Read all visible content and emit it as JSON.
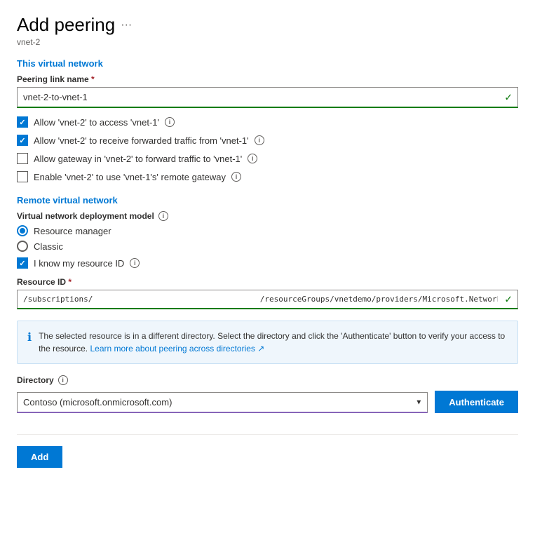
{
  "page": {
    "title": "Add peering",
    "ellipsis": "···",
    "subtitle": "vnet-2"
  },
  "thisVnet": {
    "heading": "This virtual network",
    "peeringLinkLabel": "Peering link name",
    "peeringLinkValue": "vnet-2-to-vnet-1",
    "checkboxes": [
      {
        "id": "cb1",
        "label": "Allow 'vnet-2' to access 'vnet-1'",
        "checked": true
      },
      {
        "id": "cb2",
        "label": "Allow 'vnet-2' to receive forwarded traffic from 'vnet-1'",
        "checked": true
      },
      {
        "id": "cb3",
        "label": "Allow gateway in 'vnet-2' to forward traffic to 'vnet-1'",
        "checked": false
      },
      {
        "id": "cb4",
        "label": "Enable 'vnet-2' to use 'vnet-1's' remote gateway",
        "checked": false
      }
    ]
  },
  "remoteVnet": {
    "heading": "Remote virtual network",
    "deploymentModelLabel": "Virtual network deployment model",
    "radios": [
      {
        "id": "r1",
        "label": "Resource manager",
        "selected": true
      },
      {
        "id": "r2",
        "label": "Classic",
        "selected": false
      }
    ],
    "knowResourceIdLabel": "I know my resource ID",
    "knowResourceIdChecked": true,
    "resourceIdLabel": "Resource ID",
    "resourceIdValue": "/subscriptions/                                    /resourceGroups/vnetdemo/providers/Microsoft.Network/virtual..."
  },
  "notice": {
    "text": "The selected resource is in a different directory. Select the directory and click the 'Authenticate' button to verify your access to the resource.",
    "linkText": "Learn more about peering across directories",
    "linkHref": "#"
  },
  "directory": {
    "label": "Directory",
    "value": "Contoso (microsoft.onmicrosoft.com)",
    "authenticateLabel": "Authenticate"
  },
  "footer": {
    "addLabel": "Add"
  }
}
